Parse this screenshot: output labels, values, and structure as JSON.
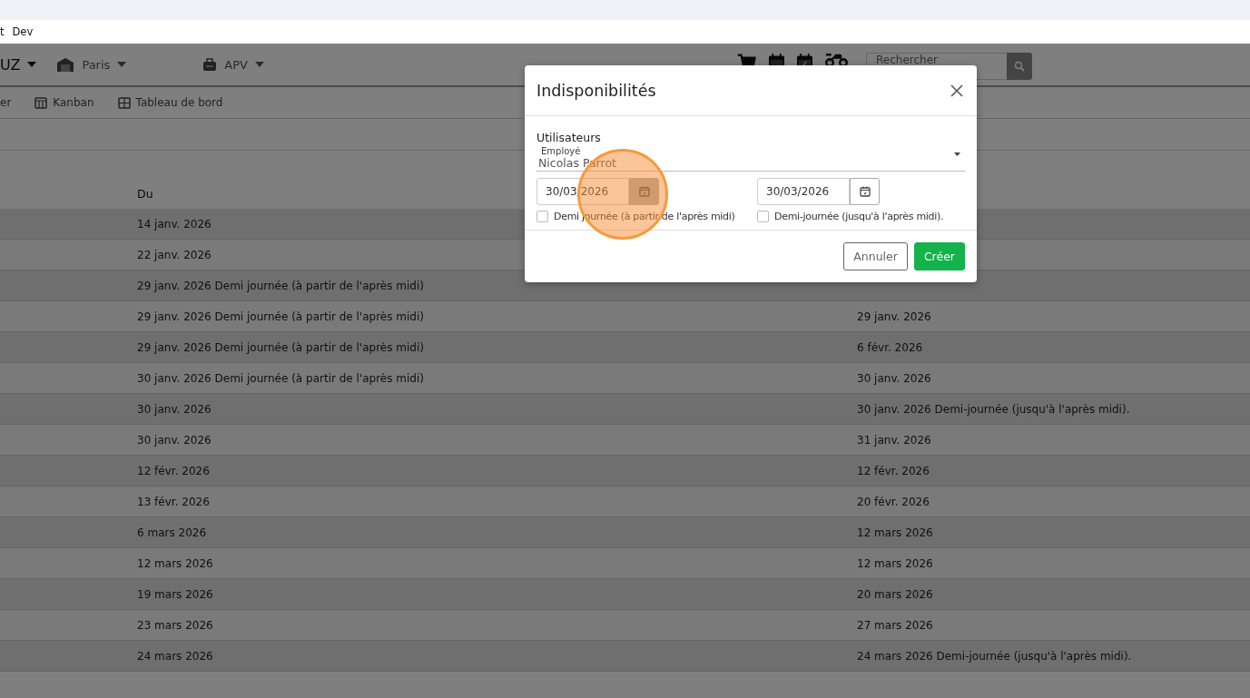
{
  "menu_bar": {
    "items": [
      "t",
      "Dev"
    ]
  },
  "navbar": {
    "items": [
      {
        "label": "UZ",
        "emphasis": true
      },
      {
        "label": "Paris",
        "emphasis": false
      },
      {
        "label": "APV",
        "emphasis": false
      }
    ],
    "search": {
      "placeholder": "Rechercher"
    }
  },
  "subnav": {
    "items": [
      "er",
      "Kanban",
      "Tableau de bord"
    ]
  },
  "table": {
    "columns": [
      "Du"
    ],
    "rows": [
      {
        "du": "14 janv. 2026"
      },
      {
        "du": "22 janv. 2026"
      },
      {
        "du": "29 janv. 2026 Demi journée (à partir de l'après midi)"
      },
      {
        "du": "29 janv. 2026 Demi journée (à partir de l'après midi)",
        "column_2": "29 janv. 2026"
      },
      {
        "du": "29 janv. 2026 Demi journée (à partir de l'après midi)",
        "column_2": "6 févr. 2026"
      },
      {
        "du": "30 janv. 2026 Demi journée (à partir de l'après midi)",
        "column_2": "30 janv. 2026"
      },
      {
        "du": "30 janv. 2026",
        "column_2": "30 janv. 2026 Demi-journée (jusqu'à l'après midi)."
      },
      {
        "du": "30 janv. 2026",
        "column_2": "31 janv. 2026"
      },
      {
        "du": "12 févr. 2026",
        "column_2": "12 févr. 2026"
      },
      {
        "du": "13 févr. 2026",
        "column_2": "20 févr. 2026"
      },
      {
        "du": "6 mars 2026",
        "column_2": "12 mars 2026"
      },
      {
        "du": "12 mars 2026",
        "column_2": "12 mars 2026"
      },
      {
        "du": "19 mars 2026",
        "column_2": "20 mars 2026"
      },
      {
        "du": "23 mars 2026",
        "column_2": "27 mars 2026"
      },
      {
        "du": "24 mars 2026",
        "column_2": "24 mars 2026 Demi-journée (jusqu'à l'après midi)."
      }
    ]
  },
  "dialog": {
    "title": "Indisponibilités",
    "section_label": "Utilisateurs",
    "employee_select": {
      "label": "Employé",
      "value": "Nicolas Parrot"
    },
    "dates": [
      {
        "value": "30/03/2026",
        "checkbox": {
          "label": "Demi journée (à partir de l'après midi)",
          "checked": false
        }
      },
      {
        "value": "30/03/2026",
        "checkbox": {
          "label": "Demi-journée (jusqu'à l'après midi).",
          "checked": false
        }
      }
    ],
    "buttons": [
      {
        "label": "Annuler",
        "kind": "secondary"
      },
      {
        "label": "Créer",
        "kind": "primary"
      }
    ]
  }
}
